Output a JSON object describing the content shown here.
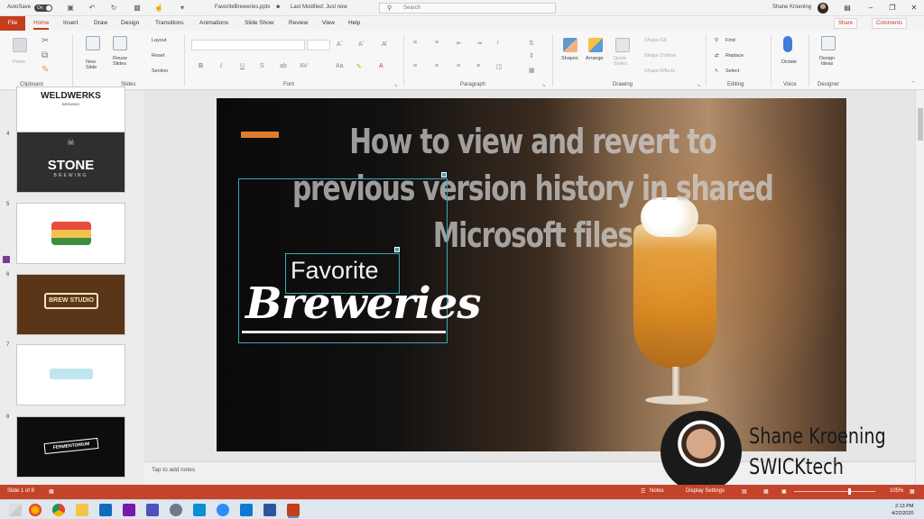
{
  "titlebar": {
    "autosave_label": "AutoSave",
    "autosave_state": "On",
    "filename": "FavoriteBreweries.pptx",
    "modified": "Last Modified: Just now",
    "search_placeholder": "Search",
    "user_name": "Shane Kroening"
  },
  "tabs": [
    "File",
    "Home",
    "Insert",
    "Draw",
    "Design",
    "Transitions",
    "Animations",
    "Slide Show",
    "Review",
    "View",
    "Help"
  ],
  "active_tab": "Home",
  "share_label": "Share",
  "comments_label": "Comments",
  "ribbon": {
    "clipboard": {
      "paste": "Paste",
      "label": "Clipboard"
    },
    "slides": {
      "new_slide": "New\nSlide",
      "reuse": "Reuse\nSlides",
      "layout": "Layout",
      "reset": "Reset",
      "section": "Section",
      "label": "Slides"
    },
    "font": {
      "label": "Font"
    },
    "paragraph": {
      "label": "Paragraph"
    },
    "drawing": {
      "shapes": "Shapes",
      "arrange": "Arrange",
      "quick_styles": "Quick\nStyles",
      "shape_fill": "Shape Fill",
      "shape_outline": "Shape Outline",
      "shape_effects": "Shape Effects",
      "label": "Drawing"
    },
    "editing": {
      "find": "Find",
      "replace": "Replace",
      "select": "Select",
      "label": "Editing"
    },
    "voice": {
      "dictate": "Dictate",
      "label": "Voice"
    },
    "designer": {
      "ideas": "Design\nIdeas",
      "label": "Designer"
    }
  },
  "thumbnails": [
    {
      "num": "",
      "text": "WELDWERKS",
      "sub": "BREWING"
    },
    {
      "num": "4",
      "text": "STONE",
      "sub": "BREWING"
    },
    {
      "num": "5",
      "text": "",
      "sub": ""
    },
    {
      "num": "6",
      "text": "BREW STUDIO",
      "sub": ""
    },
    {
      "num": "7",
      "text": "",
      "sub": ""
    },
    {
      "num": "8",
      "text": "FERMENTORIUM",
      "sub": ""
    }
  ],
  "slide": {
    "title": "How to view and revert to previous version history in shared Microsoft files",
    "favorite": "Favorite",
    "breweries": "Breweries"
  },
  "notes_placeholder": "Tap to add notes",
  "presenter": {
    "name": "Shane Kroening",
    "brand": "SWICKtech"
  },
  "status": {
    "slide": "Slide 1 of 8",
    "notes": "Notes",
    "display": "Display Settings",
    "zoom": "105%"
  },
  "clock": {
    "time": "2:13 PM",
    "date": "4/22/2020"
  },
  "colors": {
    "accent": "#c43e1c",
    "slide_accent": "#e07b2e",
    "selection": "#3aa7b8"
  }
}
